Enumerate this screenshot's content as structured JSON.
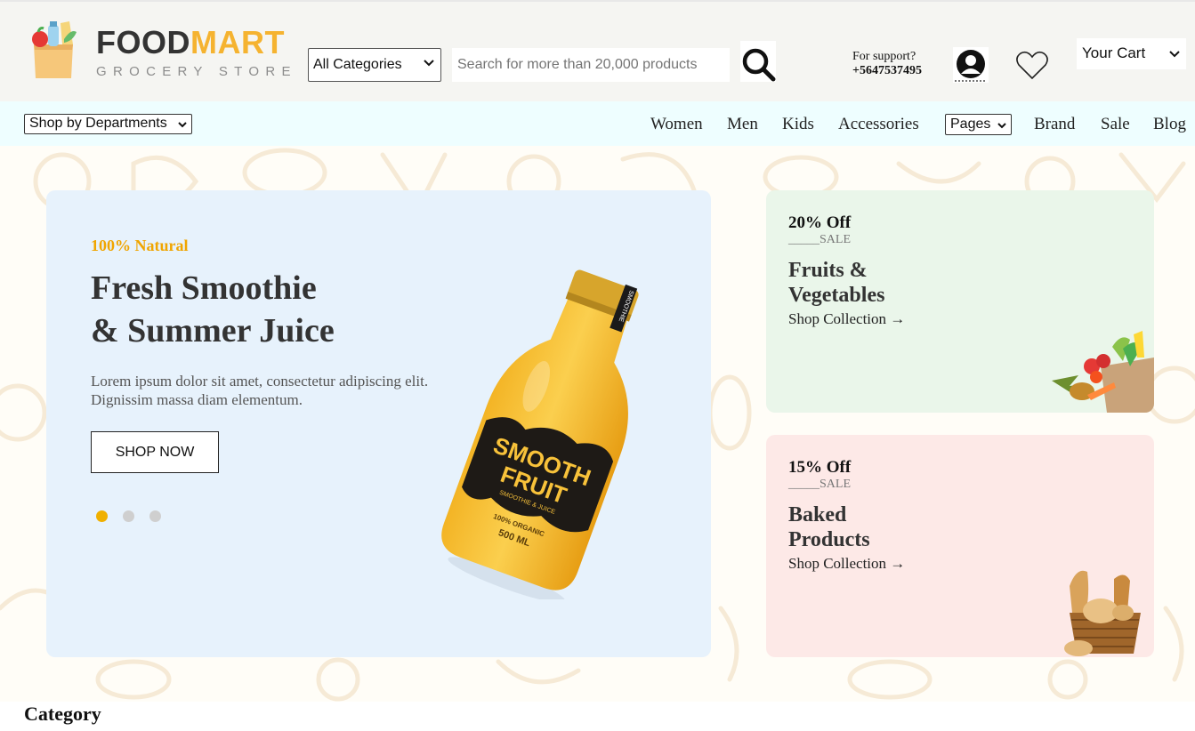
{
  "logo": {
    "title_part1": "FOOD",
    "title_part2": "MART",
    "subtitle": "GROCERY STORE"
  },
  "header": {
    "category_select": "All Categories",
    "search_placeholder": "Search for more than 20,000 products",
    "support_label": "For support?",
    "support_phone": "+5647537495",
    "cart_select": "Your Cart"
  },
  "nav": {
    "departments_select": "Shop by Departments",
    "links": [
      "Women",
      "Men",
      "Kids",
      "Accessories"
    ],
    "pages_select": "Pages",
    "links_right": [
      "Brand",
      "Sale",
      "Blog"
    ]
  },
  "hero": {
    "tagline": "100% Natural",
    "title_line1": "Fresh Smoothie",
    "title_line2": "& Summer Juice",
    "description": "Lorem ipsum dolor sit amet, consectetur adipiscing elit. Dignissim massa diam elementum.",
    "button": "SHOP NOW",
    "slides": 3,
    "active_slide": 1,
    "bottle_brand_line1": "SMOOTH",
    "bottle_brand_line2": "FRUIT",
    "bottle_sub": "SMOOTHIE & JUICE",
    "bottle_info1": "100% ORGANIC",
    "bottle_info2": "500 ML",
    "bottle_cap_label": "SMOOTHIE"
  },
  "promos": [
    {
      "off": "20% Off",
      "sale": "_____SALE",
      "title_line1": "Fruits &",
      "title_line2": "Vegetables",
      "link": "Shop Collection →"
    },
    {
      "off": "15% Off",
      "sale": "_____SALE",
      "title_line1": "Baked",
      "title_line2": "Products",
      "link": "Shop Collection →"
    }
  ],
  "section": {
    "category_title": "Category"
  },
  "colors": {
    "brand_yellow": "#f5b330",
    "banner_blue": "#e7f2fc",
    "promo_green": "#eaf6ea",
    "promo_pink": "#fde9e7",
    "nav_bg": "#eefeff"
  }
}
